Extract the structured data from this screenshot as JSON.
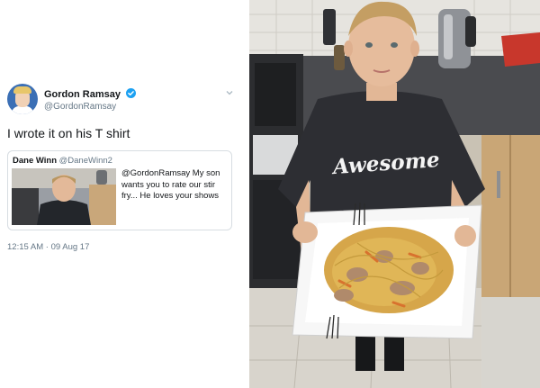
{
  "tweet": {
    "author_name": "Gordon Ramsay",
    "author_handle": "@GordonRamsay",
    "text": "I wrote it on his T shirt",
    "timestamp": "12:15 AM · 09 Aug 17",
    "verified": true
  },
  "quoted_tweet": {
    "author_name": "Dane Winn",
    "author_handle": "@DaneWinn2",
    "text": "@GordonRamsay My son wants you to rate our stir fry... He loves your shows"
  },
  "photo": {
    "shirt_text": "Awesome"
  },
  "colors": {
    "verified_blue": "#1da1f2",
    "secondary_text": "#657786",
    "border": "#d7dde2"
  },
  "icons": [
    "verified-badge-icon",
    "chevron-down-icon"
  ]
}
